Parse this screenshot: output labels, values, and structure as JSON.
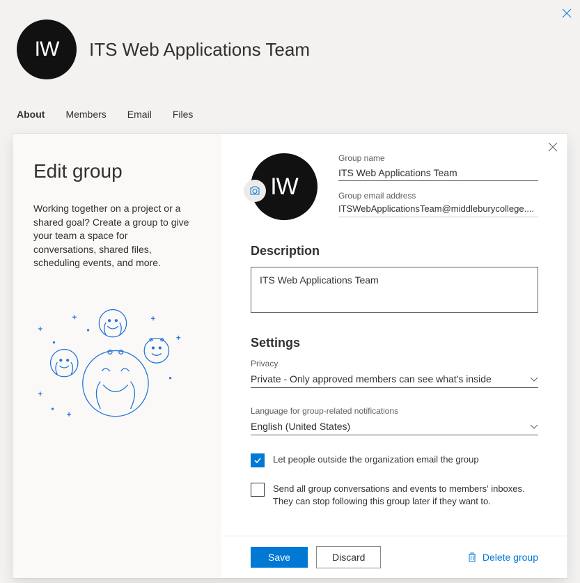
{
  "page": {
    "title": "ITS Web Applications Team",
    "avatar_initials": "IW",
    "tabs": [
      "About",
      "Members",
      "Email",
      "Files"
    ],
    "active_tab": "About"
  },
  "modal": {
    "title": "Edit group",
    "intro": "Working together on a project or a shared goal? Create a group to give your team a space for conversations, shared files, scheduling events, and more.",
    "avatar_initials": "IW",
    "group_name_label": "Group name",
    "group_name_value": "ITS Web Applications Team",
    "group_email_label": "Group email address",
    "group_email_value": "ITSWebApplicationsTeam@middleburycollege....",
    "description_heading": "Description",
    "description_value": "ITS Web Applications Team",
    "settings_heading": "Settings",
    "privacy_label": "Privacy",
    "privacy_value": "Private - Only approved members can see what's inside",
    "language_label": "Language for group-related notifications",
    "language_value": "English (United States)",
    "checkbox_external_label": "Let people outside the organization email the group",
    "checkbox_external_checked": true,
    "checkbox_sendall_label": "Send all group conversations and events to members' inboxes. They can stop following this group later if they want to.",
    "checkbox_sendall_checked": false,
    "save_label": "Save",
    "discard_label": "Discard",
    "delete_label": "Delete group"
  }
}
